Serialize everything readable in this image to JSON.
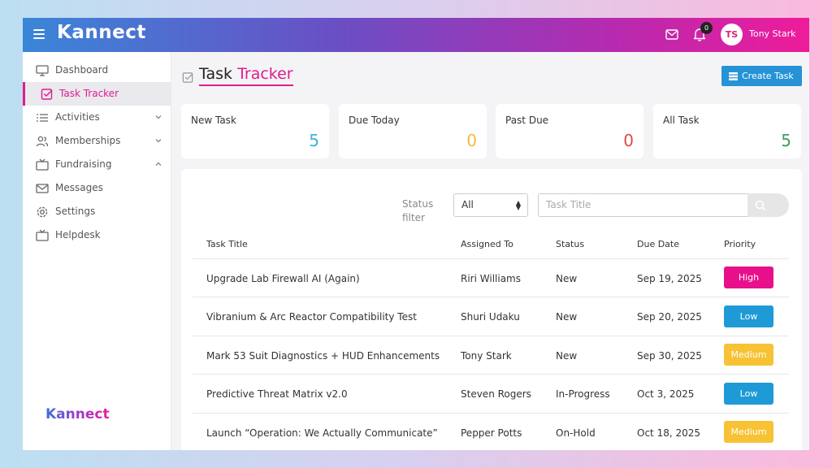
{
  "header": {
    "brand": "Kannect",
    "notification_count": "0",
    "avatar_initials": "TS",
    "username": "Tony Stark"
  },
  "sidebar": {
    "items": [
      {
        "label": "Dashboard",
        "icon": "monitor-icon"
      },
      {
        "label": "Task Tracker",
        "icon": "checkbox-icon",
        "active": true
      },
      {
        "label": "Activities",
        "icon": "list-icon",
        "chevron": "down"
      },
      {
        "label": "Memberships",
        "icon": "users-icon",
        "chevron": "down"
      },
      {
        "label": "Fundraising",
        "icon": "tv-icon",
        "chevron": "up"
      },
      {
        "label": "Messages",
        "icon": "mail-icon"
      },
      {
        "label": "Settings",
        "icon": "gear-icon"
      },
      {
        "label": "Helpdesk",
        "icon": "tv-icon"
      }
    ],
    "footer_logo": "Kannect"
  },
  "page": {
    "title_part1": "Task",
    "title_part2": "Tracker",
    "create_label": "Create Task"
  },
  "stats": [
    {
      "label": "New Task",
      "value": "5",
      "color": "#3ab3d8"
    },
    {
      "label": "Due Today",
      "value": "0",
      "color": "#f5b93a"
    },
    {
      "label": "Past Due",
      "value": "0",
      "color": "#e04848"
    },
    {
      "label": "All Task",
      "value": "5",
      "color": "#3aa05a"
    }
  ],
  "filters": {
    "status_label": "Status filter",
    "status_value": "All",
    "search_placeholder": "Task Title"
  },
  "table": {
    "headers": [
      "Task Title",
      "Assigned To",
      "Status",
      "Due Date",
      "Priority"
    ],
    "rows": [
      {
        "title": "Upgrade Lab Firewall AI (Again)",
        "assigned": "Riri Williams",
        "status": "New",
        "due": "Sep 19, 2025",
        "priority": "High",
        "priority_color": "#e8108a"
      },
      {
        "title": "Vibranium & Arc Reactor Compatibility Test",
        "assigned": "Shuri Udaku",
        "status": "New",
        "due": "Sep 20, 2025",
        "priority": "Low",
        "priority_color": "#1e9ad6"
      },
      {
        "title": "Mark 53 Suit Diagnostics + HUD Enhancements",
        "assigned": "Tony Stark",
        "status": "New",
        "due": "Sep 30, 2025",
        "priority": "Medium",
        "priority_color": "#f7c234"
      },
      {
        "title": "Predictive Threat Matrix v2.0",
        "assigned": "Steven Rogers",
        "status": "In-Progress",
        "due": "Oct 3, 2025",
        "priority": "Low",
        "priority_color": "#1e9ad6"
      },
      {
        "title": "Launch “Operation: We Actually Communicate”",
        "assigned": "Pepper Potts",
        "status": "On-Hold",
        "due": "Oct 18, 2025",
        "priority": "Medium",
        "priority_color": "#f7c234"
      }
    ]
  }
}
